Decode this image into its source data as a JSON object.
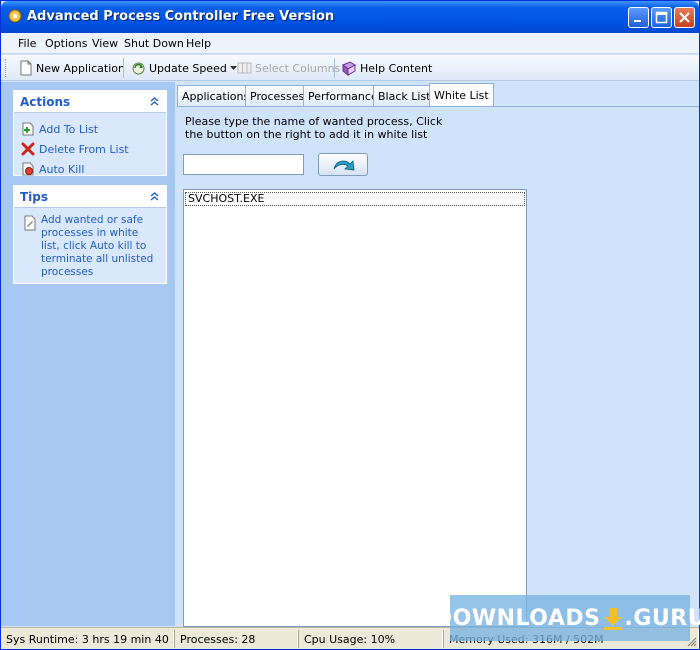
{
  "window": {
    "title": "Advanced Process Controller Free Version",
    "icon": "app-gear-icon"
  },
  "menu": [
    "File",
    "Options",
    "View",
    "Shut Down",
    "Help"
  ],
  "toolbar": {
    "new_application": "New Application",
    "update_speed": "Update Speed",
    "select_columns": "Select Columns",
    "help_content": "Help Content"
  },
  "actions_panel": {
    "title": "Actions",
    "items": [
      {
        "label": "Add To List",
        "icon": "add-icon"
      },
      {
        "label": "Delete From List",
        "icon": "delete-icon"
      },
      {
        "label": "Auto Kill",
        "icon": "auto-kill-icon"
      }
    ]
  },
  "tips_panel": {
    "title": "Tips",
    "text": "Add wanted or safe processes in white list, click Auto kill to terminate all unlisted processes"
  },
  "tabs": [
    {
      "label": "Applications",
      "active": false
    },
    {
      "label": "Processes",
      "active": false
    },
    {
      "label": "Performance",
      "active": false
    },
    {
      "label": "Black List",
      "active": false
    },
    {
      "label": "White List",
      "active": true
    }
  ],
  "whitelist": {
    "instruction": "Please type the name of wanted process, Click the button on the right to add it in white list",
    "input_value": "",
    "items": [
      "SVCHOST.EXE"
    ]
  },
  "status": {
    "runtime": "Sys Runtime: 3 hrs 19 min 40 s",
    "processes": "Processes: 28",
    "cpu": "Cpu Usage: 10%",
    "memory": "Memory Used: 316M / 502M"
  },
  "watermark": {
    "left": "DOWNLOADS",
    "right": ".GURU"
  },
  "colors": {
    "title_blue": "#0055e5",
    "panel_link": "#215dc6",
    "pane_bg": "#a6c8f2"
  }
}
